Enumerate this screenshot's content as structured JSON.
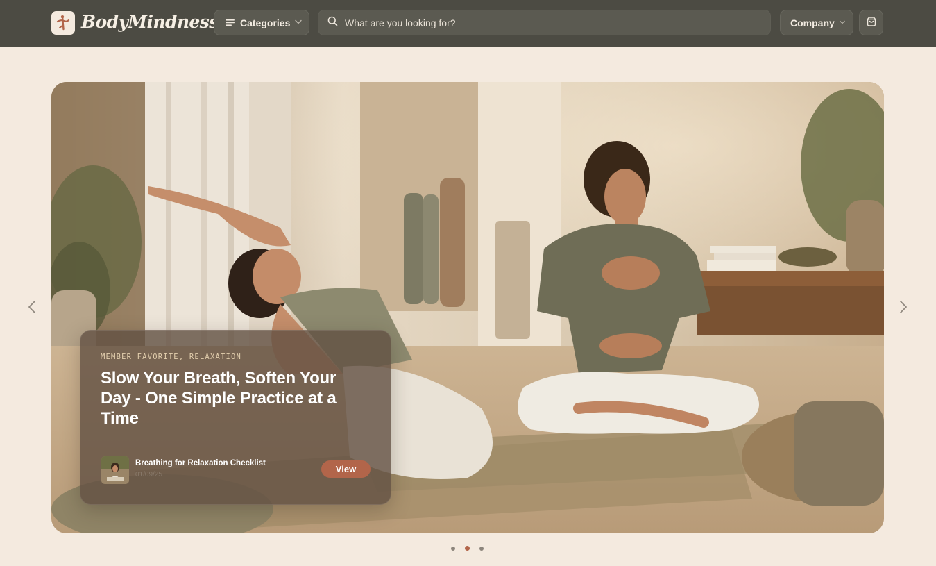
{
  "brand": {
    "name": "BodyMindness"
  },
  "nav": {
    "categories_label": "Categories",
    "search_placeholder": "What are you looking for?",
    "company_label": "Company"
  },
  "hero": {
    "tags": "MEMBER FAVORITE, RELAXATION",
    "title": "Slow Your Breath, Soften Your Day - One Simple Practice at a Time",
    "item": {
      "title": "Breathing for Relaxation Checklist",
      "subtitle": "01/09/25",
      "button_label": "View"
    },
    "slides": {
      "count": 3,
      "active_index": 1
    }
  },
  "colors": {
    "nav_background": "#4c4b43",
    "page_background": "#f4eadf",
    "accent": "#b2654a"
  },
  "icons": [
    "bodymindness-logo-icon",
    "menu-lines-icon",
    "chevron-down-icon",
    "search-icon",
    "shopping-bag-icon",
    "chevron-left-icon",
    "chevron-right-icon"
  ]
}
